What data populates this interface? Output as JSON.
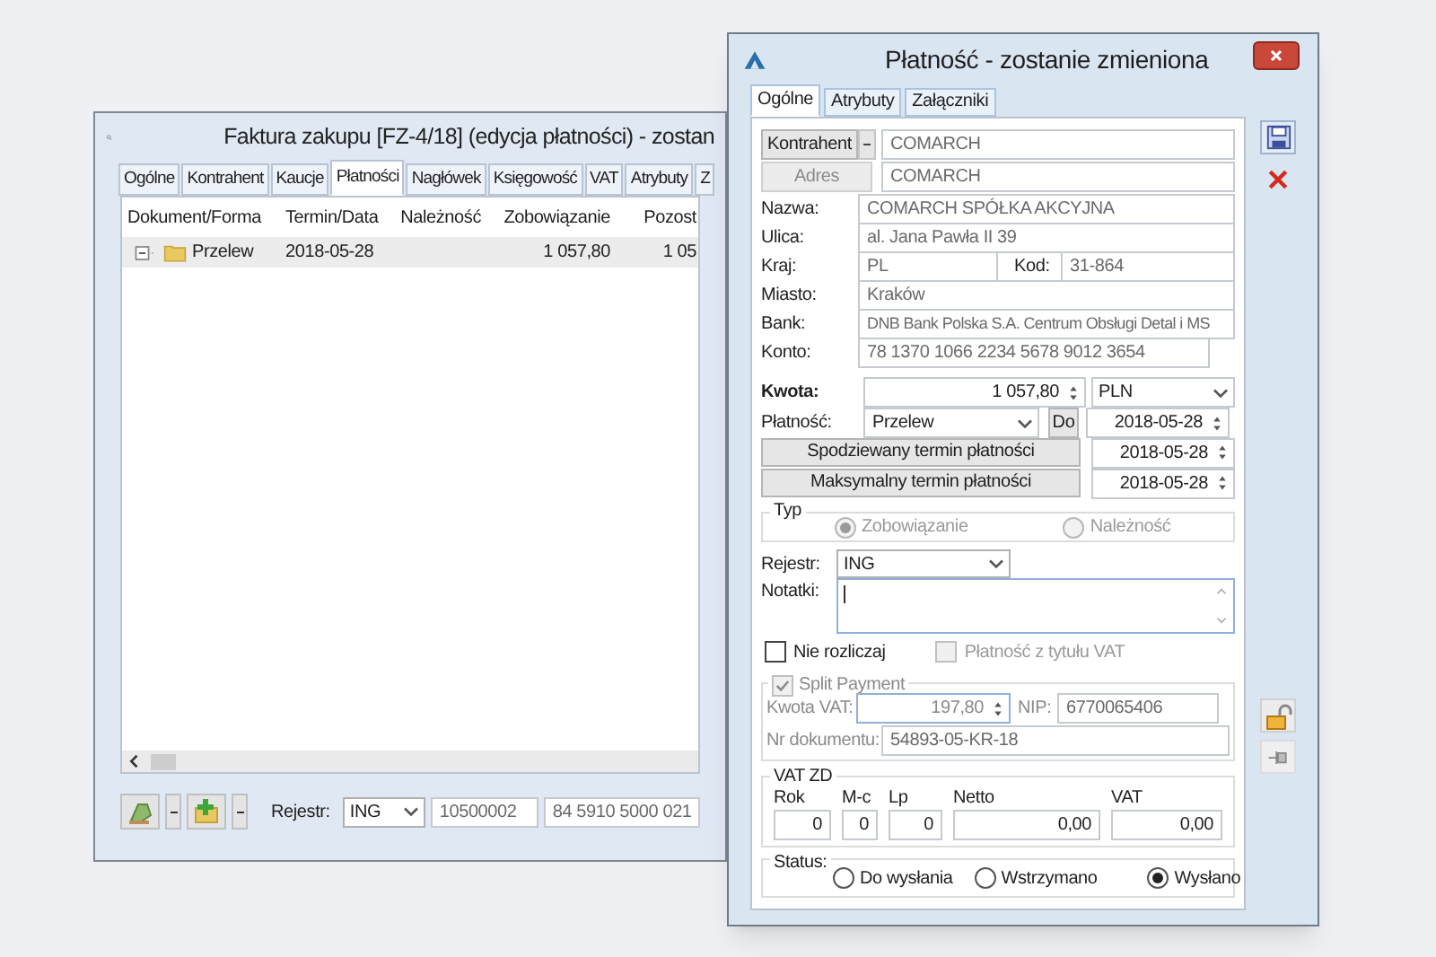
{
  "back_window": {
    "title": "Faktura zakupu [FZ-4/18] (edycja płatności) - zostan",
    "tabs": [
      {
        "label": "Ogólne",
        "selected": false
      },
      {
        "label": "Kontrahent",
        "selected": false
      },
      {
        "label": "Kaucje",
        "selected": false
      },
      {
        "label": "Płatności",
        "selected": true
      },
      {
        "label": "Nagłówek",
        "selected": false
      },
      {
        "label": "Księgowość",
        "selected": false
      },
      {
        "label": "VAT",
        "selected": false
      },
      {
        "label": "Atrybuty",
        "selected": false
      },
      {
        "label": "Z",
        "selected": false
      }
    ],
    "columns": [
      "Dokument/Forma",
      "Termin/Data",
      "Należność",
      "Zobowiązanie",
      "Pozost"
    ],
    "rows": [
      {
        "expanded": true,
        "selected": true,
        "cells": [
          "Przelew",
          "2018-05-28",
          "",
          "1 057,80",
          "1 05"
        ]
      }
    ],
    "footer": {
      "register_label": "Rejestr:",
      "register": "ING",
      "field_1": "10500002",
      "field_2": "84 5910 5000 021"
    }
  },
  "dialog": {
    "title": "Płatność - zostanie zmieniona",
    "tabs": [
      {
        "label": "Ogólne",
        "selected": true
      },
      {
        "label": "Atrybuty",
        "selected": false
      },
      {
        "label": "Załączniki",
        "selected": false
      }
    ],
    "contractor_button": "Kontrahent",
    "contractor": "COMARCH",
    "address_button": "Adres",
    "address": "COMARCH",
    "name": {
      "label": "Nazwa:",
      "value": "COMARCH SPÓŁKA AKCYJNA"
    },
    "street": {
      "label": "Ulica:",
      "value": "al. Jana Pawła II 39"
    },
    "country": {
      "label": "Kraj:",
      "value": "PL"
    },
    "postcode": {
      "label": "Kod:",
      "value": "31-864"
    },
    "city": {
      "label": "Miasto:",
      "value": "Kraków"
    },
    "bank": {
      "label": "Bank:",
      "value": "DNB Bank Polska S.A. Centrum Obsługi Detal i MS"
    },
    "account": {
      "label": "Konto:",
      "value": "78 1370 1066 2234 5678 9012 3654"
    },
    "amount": {
      "label": "Kwota:",
      "value": "1 057,80",
      "currency": "PLN"
    },
    "payment": {
      "label": "Płatność:",
      "method": "Przelew",
      "button": "Do",
      "date": "2018-05-28"
    },
    "date_buttons": [
      {
        "label": "Spodziewany termin płatności",
        "date": "2018-05-28"
      },
      {
        "label": "Maksymalny termin płatności",
        "date": "2018-05-28"
      }
    ],
    "type": {
      "label": "Typ",
      "disabled": true,
      "options": [
        {
          "label": "Zobowiązanie",
          "selected": true
        },
        {
          "label": "Należność",
          "selected": false
        }
      ]
    },
    "register": {
      "label": "Rejestr:",
      "value": "ING"
    },
    "notes": {
      "label": "Notatki:"
    },
    "checks": [
      {
        "label": "Nie rozliczaj",
        "checked": false,
        "disabled": false
      },
      {
        "label": "Płatność z tytułu VAT",
        "checked": false,
        "disabled": true
      }
    ],
    "split_payment": {
      "label": "Split Payment",
      "checked": true,
      "disabled": true,
      "vat_label": "Kwota VAT:",
      "vat": "197,80",
      "nip_label": "NIP:",
      "nip": "6770065406",
      "doc_label": "Nr dokumentu:",
      "doc": "54893-05-KR-18"
    },
    "vat_zd": {
      "title": "VAT ZD",
      "fields": [
        {
          "label": "Rok",
          "value": "0"
        },
        {
          "label": "M-c",
          "value": "0"
        },
        {
          "label": "Lp",
          "value": "0"
        },
        {
          "label": "Netto",
          "value": "0,00"
        },
        {
          "label": "VAT",
          "value": "0,00"
        }
      ]
    },
    "status": {
      "label": "Status:",
      "options": [
        {
          "label": "Do wysłania",
          "selected": false
        },
        {
          "label": "Wstrzymano",
          "selected": false
        },
        {
          "label": "Wysłano",
          "selected": true
        }
      ]
    }
  }
}
